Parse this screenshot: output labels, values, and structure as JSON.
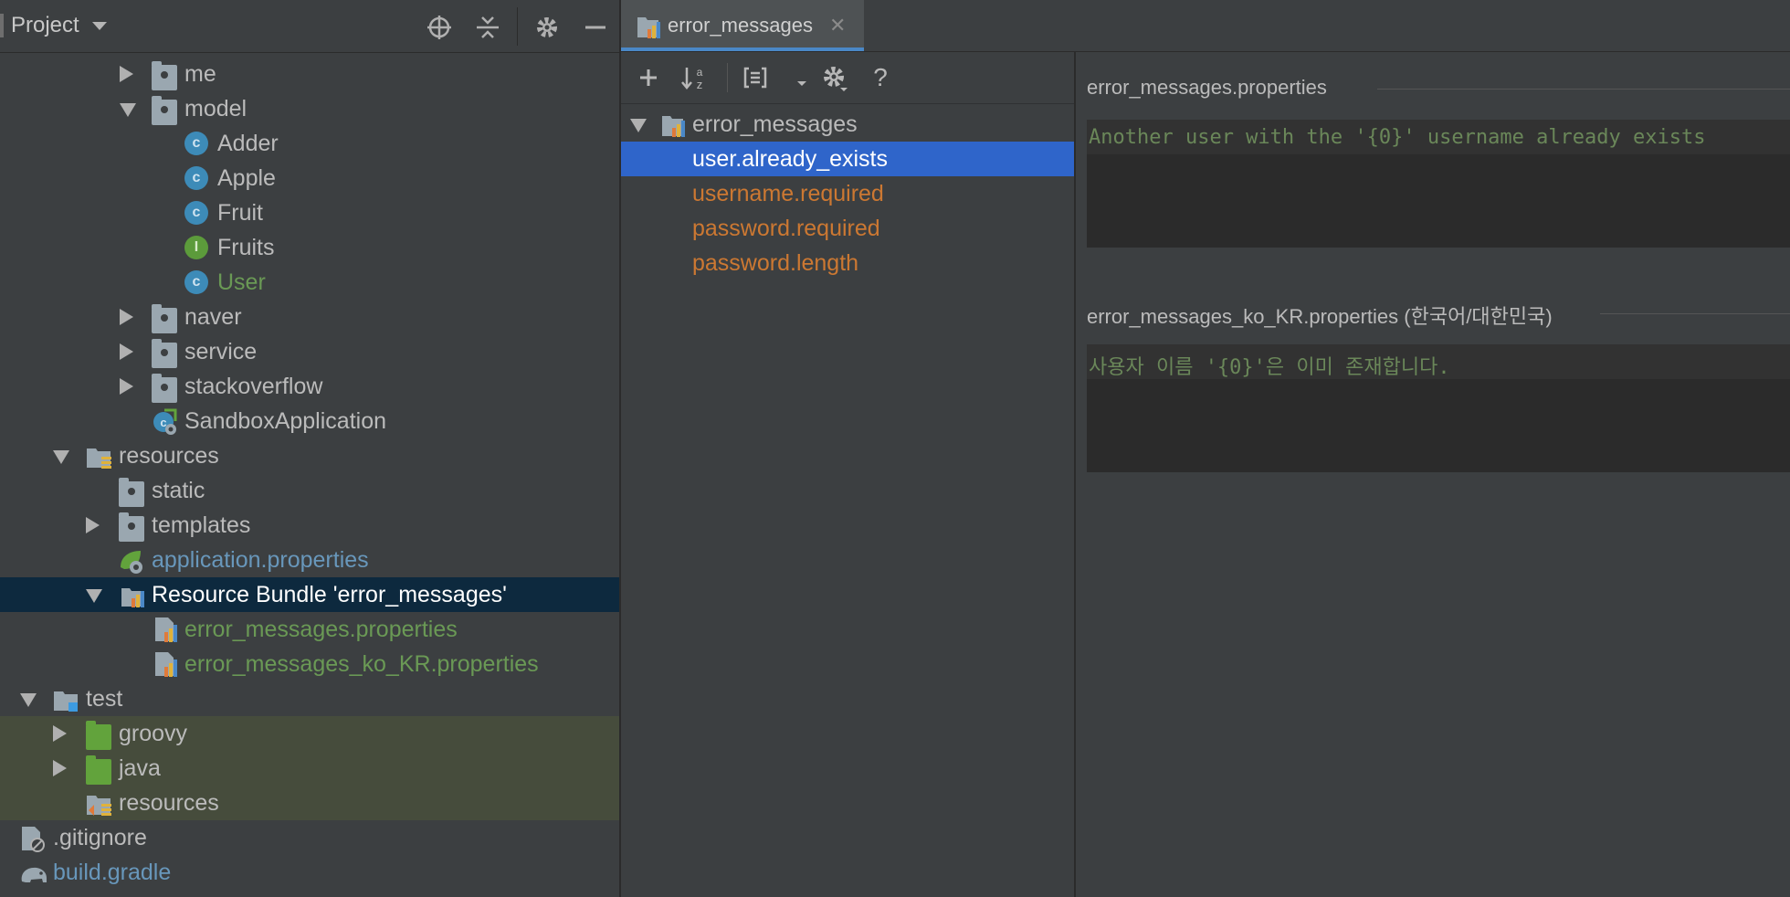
{
  "project_panel": {
    "title": "Project",
    "tree": [
      {
        "label": "me",
        "kind": "package"
      },
      {
        "label": "model",
        "kind": "package"
      },
      {
        "label": "Adder",
        "kind": "class"
      },
      {
        "label": "Apple",
        "kind": "class"
      },
      {
        "label": "Fruit",
        "kind": "class"
      },
      {
        "label": "Fruits",
        "kind": "interface"
      },
      {
        "label": "User",
        "kind": "class"
      },
      {
        "label": "naver",
        "kind": "package"
      },
      {
        "label": "service",
        "kind": "package"
      },
      {
        "label": "stackoverflow",
        "kind": "package"
      },
      {
        "label": "SandboxApplication",
        "kind": "spring-app"
      },
      {
        "label": "resources",
        "kind": "resources-folder"
      },
      {
        "label": "static",
        "kind": "package"
      },
      {
        "label": "templates",
        "kind": "package"
      },
      {
        "label": "application.properties",
        "kind": "spring-properties"
      },
      {
        "label": "Resource Bundle 'error_messages'",
        "kind": "resource-bundle"
      },
      {
        "label": "error_messages.properties",
        "kind": "bundle-file"
      },
      {
        "label": "error_messages_ko_KR.properties",
        "kind": "bundle-file"
      },
      {
        "label": "test",
        "kind": "test-folder"
      },
      {
        "label": "groovy",
        "kind": "test-source-folder"
      },
      {
        "label": "java",
        "kind": "test-source-folder"
      },
      {
        "label": "resources",
        "kind": "test-resources-folder"
      },
      {
        "label": ".gitignore",
        "kind": "ignore-file"
      },
      {
        "label": "build.gradle",
        "kind": "gradle-file"
      }
    ]
  },
  "editor": {
    "tab_label": "error_messages",
    "bundle_root": "error_messages",
    "keys": [
      "user.already_exists",
      "username.required",
      "password.required",
      "password.length"
    ],
    "selected_key": "user.already_exists",
    "values": [
      {
        "file": "error_messages.properties",
        "value": "Another user with the '{0}' username already exists"
      },
      {
        "file": "error_messages_ko_KR.properties (한국어/대한민국)",
        "value": "사용자 이름 '{0}'은 이미 존재합니다."
      }
    ]
  },
  "colors": {
    "background": "#3c3f41",
    "selection": "#2f65ca",
    "tree_selection": "#0d293e",
    "key_text": "#cc7832",
    "green_text": "#6a8759",
    "blue_link": "#6897bb"
  }
}
